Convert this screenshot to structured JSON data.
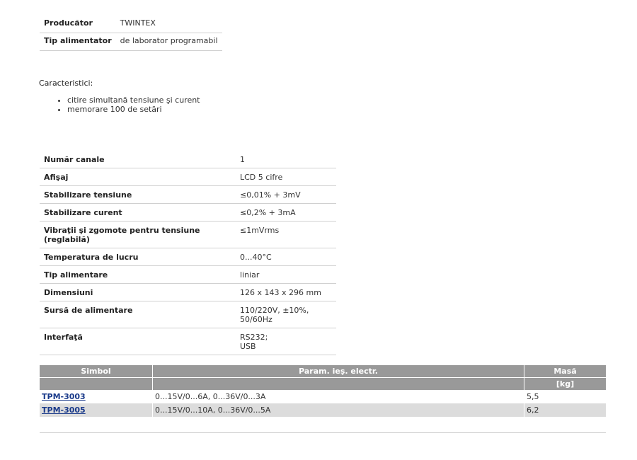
{
  "top_specs": [
    {
      "label": "Producător",
      "value": "TWINTEX"
    },
    {
      "label": "Tip alimentator",
      "value": "de laborator programabil"
    }
  ],
  "characteristics": {
    "heading": "Caracteristici:",
    "items": [
      "citire simultană tensiune şi curent",
      "memorare 100 de setări"
    ]
  },
  "specs": [
    {
      "label": "Număr canale",
      "value": "1"
    },
    {
      "label": "Afişaj",
      "value": "LCD 5 cifre"
    },
    {
      "label": "Stabilizare tensiune",
      "value": "≤0,01% + 3mV"
    },
    {
      "label": "Stabilizare curent",
      "value": "≤0,2% + 3mA"
    },
    {
      "label": "Vibraţii şi zgomote pentru tensiune (reglabilă)",
      "value": "≤1mVrms"
    },
    {
      "label": "Temperatura de lucru",
      "value": "0...40°C"
    },
    {
      "label": "Tip alimentare",
      "value": "liniar"
    },
    {
      "label": "Dimensiuni",
      "value": "126 x 143 x 296 mm"
    },
    {
      "label": "Sursă de alimentare",
      "value": "110/220V, ±10%, 50/60Hz"
    },
    {
      "label": "Interfaţă",
      "value_lines": [
        "RS232;",
        "USB"
      ]
    }
  ],
  "models": {
    "headers": {
      "symbol": "Simbol",
      "params": "Param. ieş. electr.",
      "mass": "Masă",
      "mass_unit": "[kg]"
    },
    "rows": [
      {
        "symbol": "TPM-3003",
        "params": "0...15V/0...6A, 0...36V/0...3A",
        "mass": "5,5"
      },
      {
        "symbol": "TPM-3005",
        "params": "0...15V/0...10A, 0...36V/0...5A",
        "mass": "6,2"
      }
    ]
  }
}
